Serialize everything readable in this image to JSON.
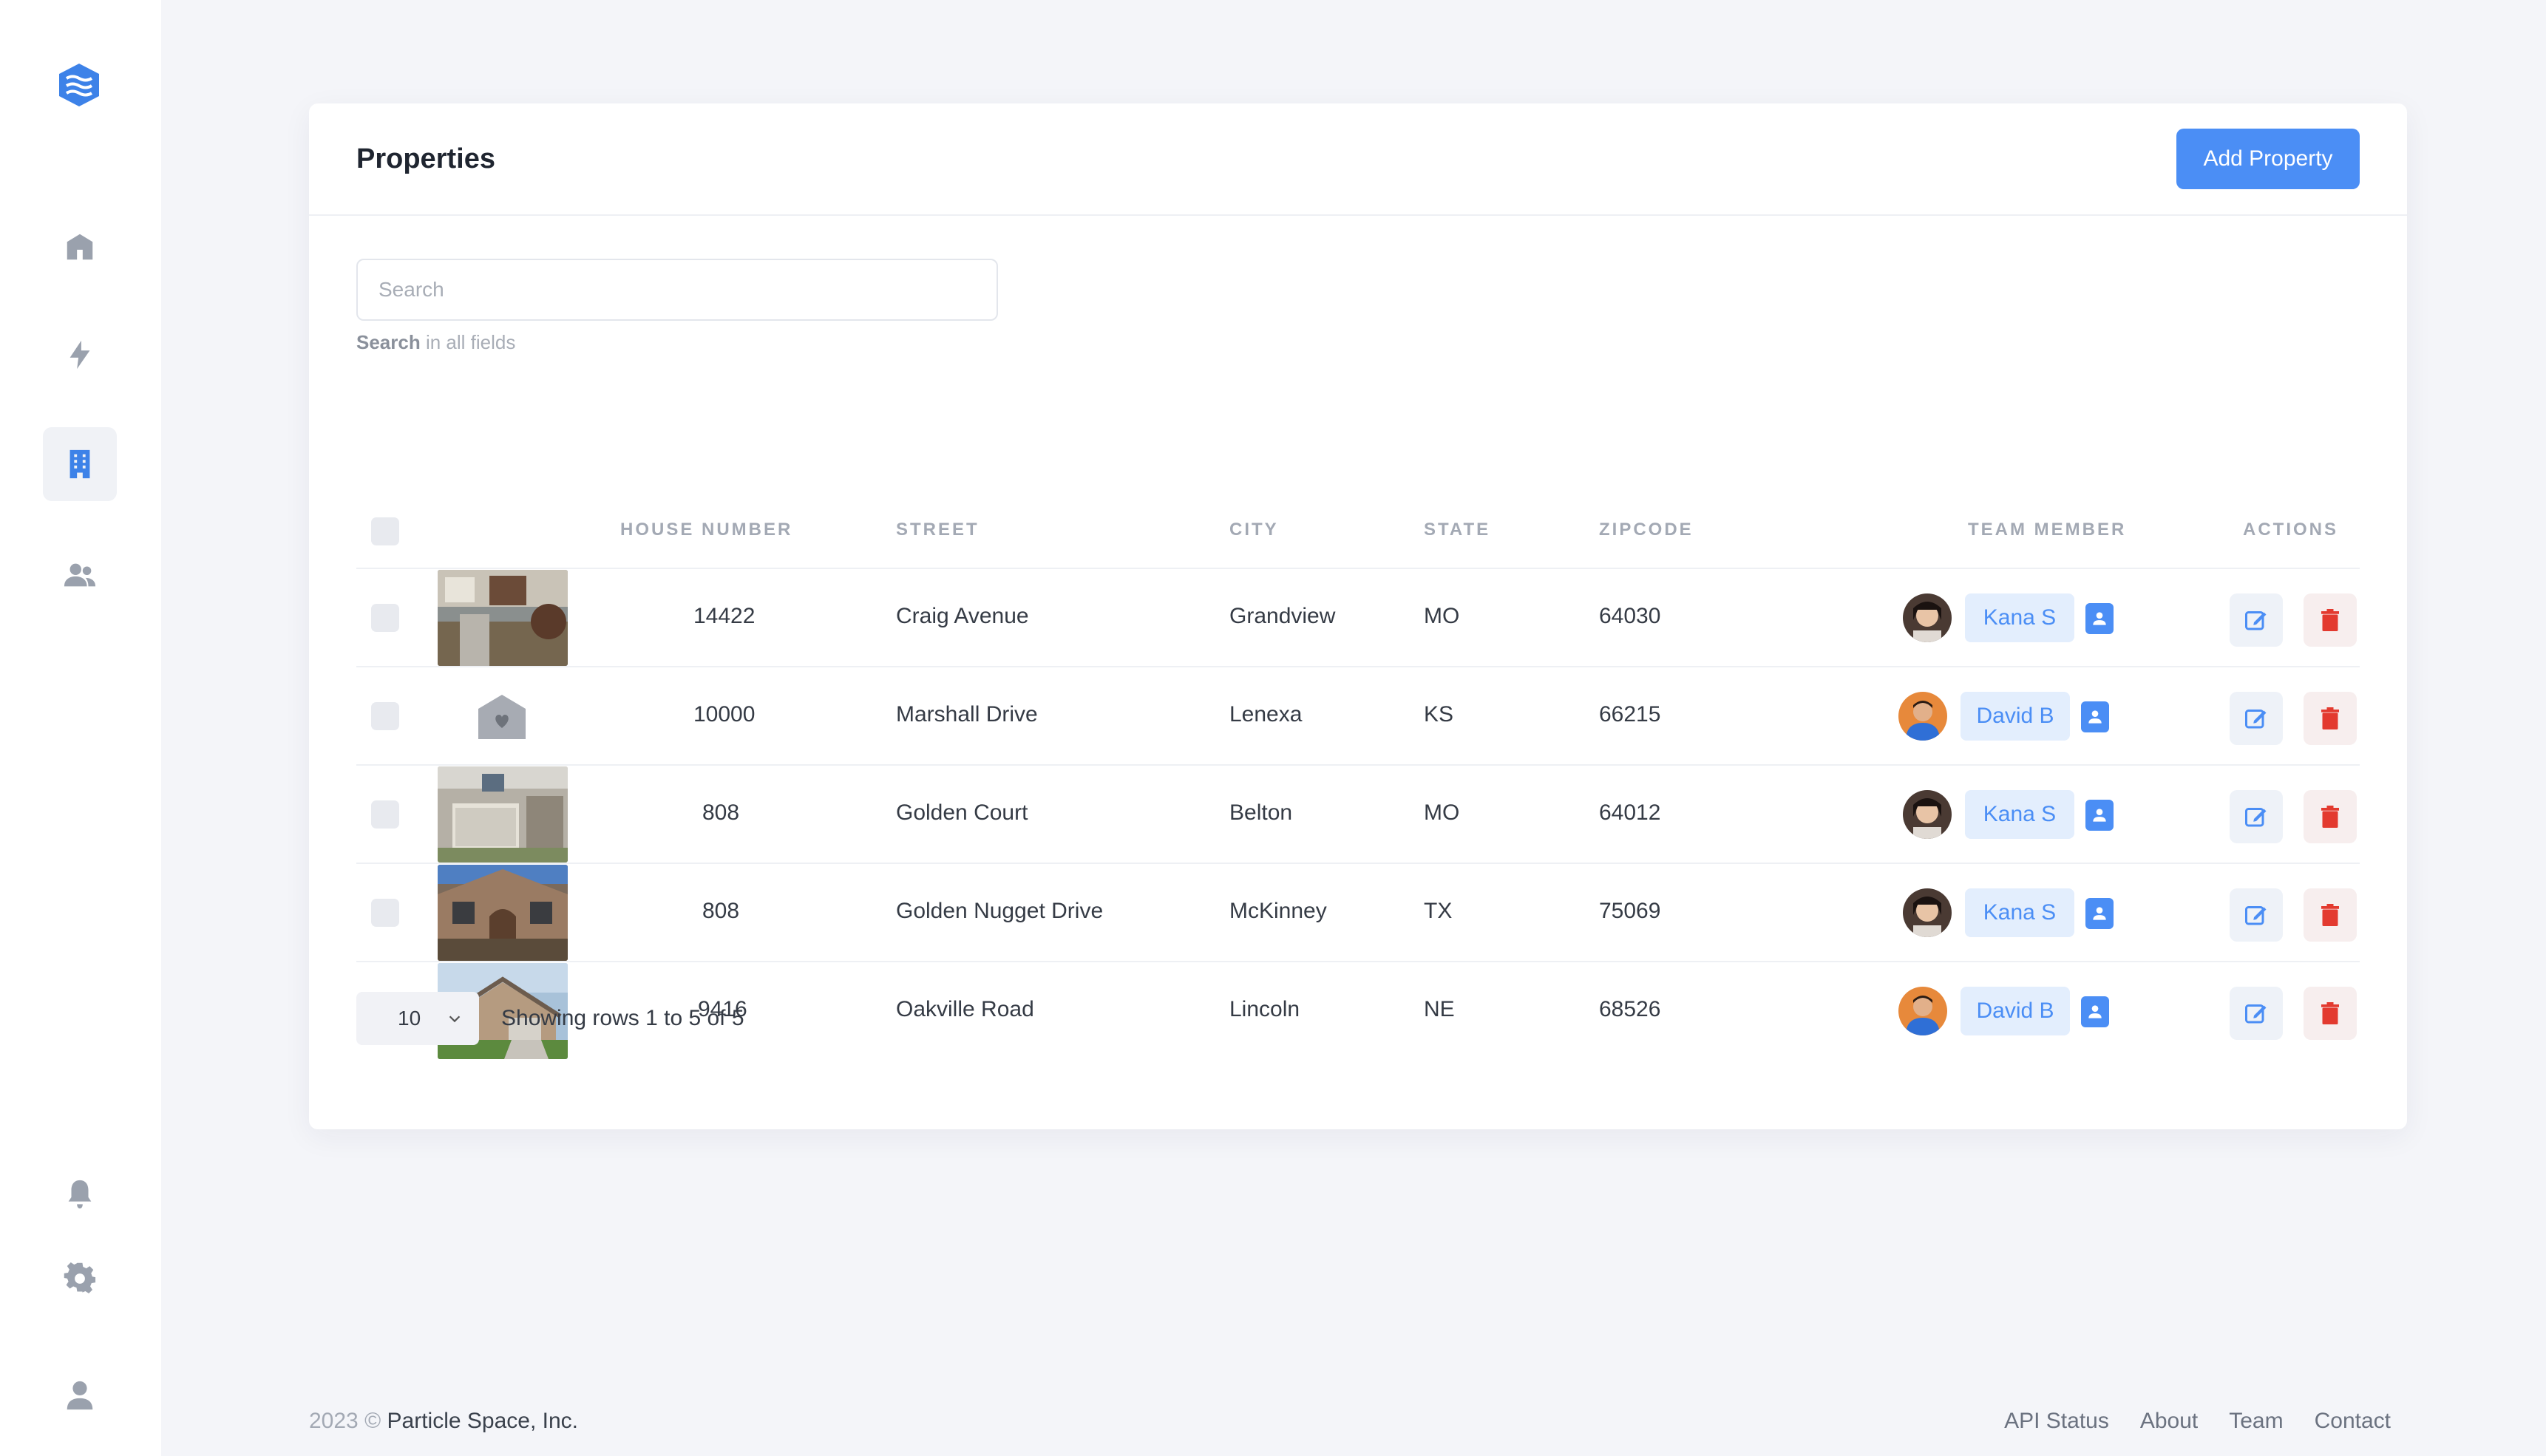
{
  "app": {
    "brand_color": "#4b8ef5"
  },
  "sidebar": {
    "items": [
      {
        "icon": "home-icon",
        "active": false
      },
      {
        "icon": "bolt-icon",
        "active": false
      },
      {
        "icon": "building-icon",
        "active": true
      },
      {
        "icon": "users-icon",
        "active": false
      },
      {
        "icon": "bell-icon",
        "active": false
      },
      {
        "icon": "gear-icon",
        "active": false
      },
      {
        "icon": "user-icon",
        "active": false
      }
    ]
  },
  "header": {
    "title": "Properties",
    "add_button": "Add Property"
  },
  "search": {
    "placeholder": "Search",
    "hint_bold": "Search",
    "hint_rest": " in all fields"
  },
  "table": {
    "columns": [
      "House Number",
      "Street",
      "City",
      "State",
      "Zipcode",
      "Team Member",
      "Actions"
    ],
    "rows": [
      {
        "house_number": "14422",
        "street": "Craig Avenue",
        "city": "Grandview",
        "state": "MO",
        "zipcode": "64030",
        "member": "Kana S",
        "image": "photo"
      },
      {
        "house_number": "10000",
        "street": "Marshall Drive",
        "city": "Lenexa",
        "state": "KS",
        "zipcode": "66215",
        "member": "David B",
        "image": "placeholder"
      },
      {
        "house_number": "808",
        "street": "Golden Court",
        "city": "Belton",
        "state": "MO",
        "zipcode": "64012",
        "member": "Kana S",
        "image": "photo"
      },
      {
        "house_number": "808",
        "street": "Golden Nugget Drive",
        "city": "McKinney",
        "state": "TX",
        "zipcode": "75069",
        "member": "Kana S",
        "image": "photo"
      },
      {
        "house_number": "9416",
        "street": "Oakville Road",
        "city": "Lincoln",
        "state": "NE",
        "zipcode": "68526",
        "member": "David B",
        "image": "photo"
      }
    ]
  },
  "pagination": {
    "page_size": "10",
    "summary": "Showing rows 1 to 5 of 5"
  },
  "footer": {
    "copyright_prefix": "2023 © ",
    "company": "Particle Space, Inc.",
    "links": [
      "API Status",
      "About",
      "Team",
      "Contact"
    ]
  }
}
